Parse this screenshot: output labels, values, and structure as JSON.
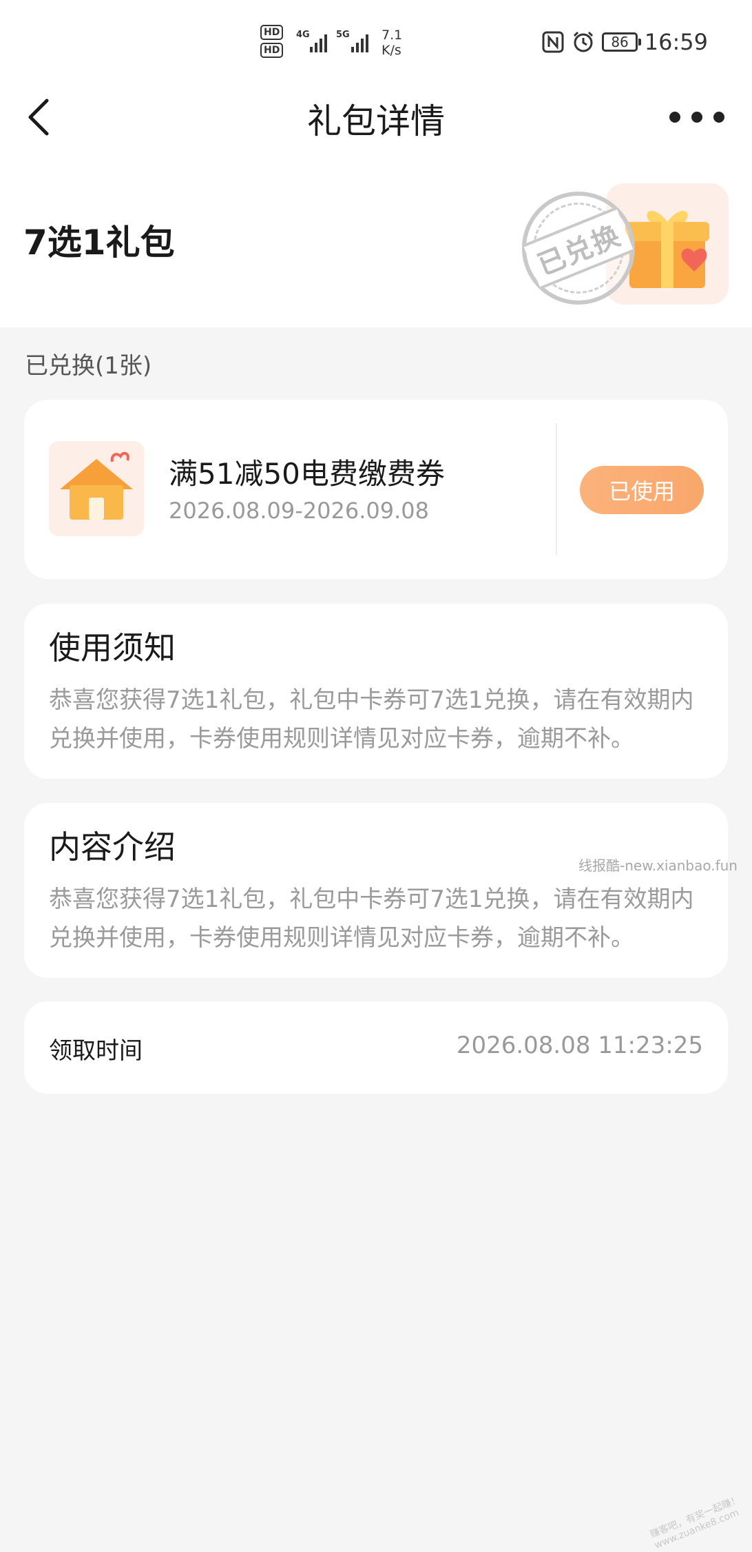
{
  "status_bar": {
    "hd1": "HD",
    "hd2": "HD",
    "net1": "4G",
    "net2": "5G",
    "speed_value": "7.1",
    "speed_unit": "K/s",
    "battery": "86",
    "time": "16:59",
    "icons": [
      "nfc-icon",
      "alarm-icon"
    ]
  },
  "nav": {
    "title": "礼包详情",
    "back_icon": "chevron-left-icon",
    "more_icon": "more-dots-icon"
  },
  "package": {
    "title": "7选1礼包",
    "stamp_text": "已兑换",
    "gift_icon": "gift-box-icon"
  },
  "redeemed_section": {
    "label": "已兑换(1张)"
  },
  "coupon": {
    "name": "满51减50电费缴费券",
    "validity": "2026.08.09-2026.09.08",
    "status_button": "已使用",
    "icon": "house-icon"
  },
  "notice": {
    "heading": "使用须知",
    "body": "恭喜您获得7选1礼包，礼包中卡券可7选1兑换，请在有效期内兑换并使用，卡券使用规则详情见对应卡券，逾期不补。"
  },
  "intro": {
    "heading": "内容介绍",
    "body": "恭喜您获得7选1礼包，礼包中卡券可7选1兑换，请在有效期内兑换并使用，卡券使用规则详情见对应卡券，逾期不补。"
  },
  "receive_time": {
    "label": "领取时间",
    "value": "2026.08.08 11:23:25"
  },
  "watermarks": {
    "w1": "线报酷-new.xianbao.fun",
    "w2": "赚客吧，有奖一起赚！ www.zuanke8.com"
  },
  "colors": {
    "accent_orange": "#f9a76b",
    "page_bg": "#f5f5f5",
    "card_bg": "#ffffff",
    "muted_text": "#999999"
  }
}
